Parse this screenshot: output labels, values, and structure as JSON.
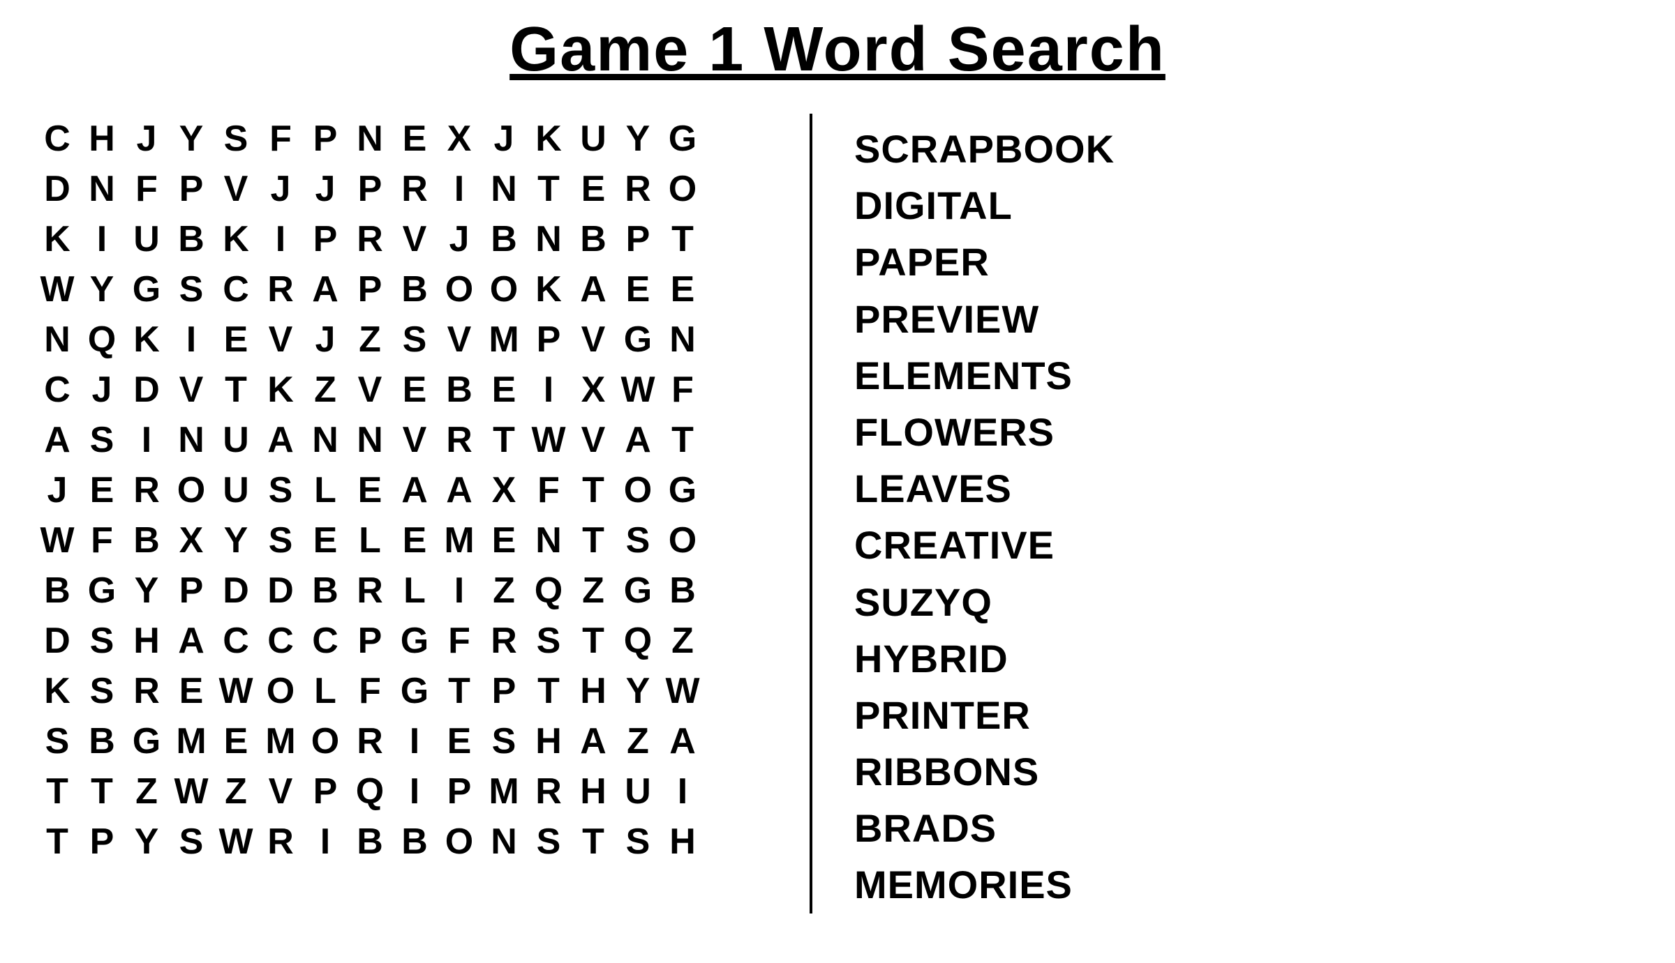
{
  "title": "Game 1 Word Search",
  "grid": [
    [
      "C",
      "H",
      "J",
      "Y",
      "S",
      "F",
      "P",
      "N",
      "E",
      "X",
      "J",
      "K",
      "U",
      "Y",
      "G"
    ],
    [
      "D",
      "N",
      "F",
      "P",
      "V",
      "J",
      "J",
      "P",
      "R",
      "I",
      "N",
      "T",
      "E",
      "R",
      "O"
    ],
    [
      "K",
      "I",
      "U",
      "B",
      "K",
      "I",
      "P",
      "R",
      "V",
      "J",
      "B",
      "N",
      "B",
      "P",
      "T"
    ],
    [
      "W",
      "Y",
      "G",
      "S",
      "C",
      "R",
      "A",
      "P",
      "B",
      "O",
      "O",
      "K",
      "A",
      "E",
      "E"
    ],
    [
      "N",
      "Q",
      "K",
      "I",
      "E",
      "V",
      "J",
      "Z",
      "S",
      "V",
      "M",
      "P",
      "V",
      "G",
      "N"
    ],
    [
      "C",
      "J",
      "D",
      "V",
      "T",
      "K",
      "Z",
      "V",
      "E",
      "B",
      "E",
      "I",
      "X",
      "W",
      "F"
    ],
    [
      "A",
      "S",
      "I",
      "N",
      "U",
      "A",
      "N",
      "N",
      "V",
      "R",
      "T",
      "W",
      "V",
      "A",
      "T"
    ],
    [
      "J",
      "E",
      "R",
      "O",
      "U",
      "S",
      "L",
      "E",
      "A",
      "A",
      "X",
      "F",
      "T",
      "O",
      "G"
    ],
    [
      "W",
      "F",
      "B",
      "X",
      "Y",
      "S",
      "E",
      "L",
      "E",
      "M",
      "E",
      "N",
      "T",
      "S",
      "O"
    ],
    [
      "B",
      "G",
      "Y",
      "P",
      "D",
      "D",
      "B",
      "R",
      "L",
      "I",
      "Z",
      "Q",
      "Z",
      "G",
      "B"
    ],
    [
      "D",
      "S",
      "H",
      "A",
      "C",
      "C",
      "C",
      "P",
      "G",
      "F",
      "R",
      "S",
      "T",
      "Q",
      "Z"
    ],
    [
      "K",
      "S",
      "R",
      "E",
      "W",
      "O",
      "L",
      "F",
      "G",
      "T",
      "P",
      "T",
      "H",
      "Y",
      "W"
    ],
    [
      "S",
      "B",
      "G",
      "M",
      "E",
      "M",
      "O",
      "R",
      "I",
      "E",
      "S",
      "H",
      "A",
      "Z",
      "A"
    ],
    [
      "T",
      "T",
      "Z",
      "W",
      "Z",
      "V",
      "P",
      "Q",
      "I",
      "P",
      "M",
      "R",
      "H",
      "U",
      "I"
    ],
    [
      "T",
      "P",
      "Y",
      "S",
      "W",
      "R",
      "I",
      "B",
      "B",
      "O",
      "N",
      "S",
      "T",
      "S",
      "H"
    ]
  ],
  "words": [
    "SCRAPBOOK",
    "DIGITAL",
    "PAPER",
    "PREVIEW",
    "ELEMENTS",
    "FLOWERS",
    "LEAVES",
    "CREATIVE",
    "SUZYQ",
    "HYBRID",
    "PRINTER",
    "RIBBONS",
    "BRADS",
    "MEMORIES"
  ]
}
